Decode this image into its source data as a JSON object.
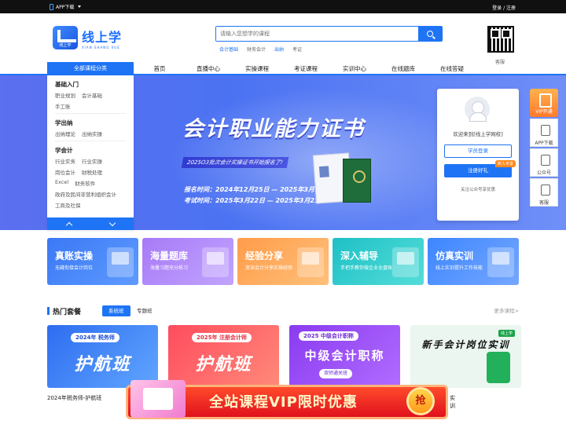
{
  "topbar": {
    "app_download": "APP下载",
    "login_register": "登录 / 注册"
  },
  "logo": {
    "name": "线上学",
    "pinyin": "XIAN SHANG XUE",
    "mark_text": "线上学"
  },
  "search": {
    "placeholder": "请输入您想学的课程",
    "hot": [
      "会计基础",
      "财务会计",
      "出纳",
      "考证"
    ]
  },
  "qr": {
    "label": "客服"
  },
  "nav": {
    "all_categories": "全部课程分类",
    "items": [
      "首页",
      "直播中心",
      "实操课程",
      "考证课程",
      "实训中心",
      "在线题库",
      "在线答疑"
    ]
  },
  "categories": [
    {
      "title": "基础入门",
      "rows": [
        [
          "职业规划",
          "会计基础"
        ],
        [
          "手工账"
        ]
      ]
    },
    {
      "title": "学出纳",
      "rows": [
        [
          "出纳理论",
          "出纳实操"
        ]
      ]
    },
    {
      "title": "学会计",
      "rows": [
        [
          "行业实务",
          "行业实操"
        ],
        [
          "岗位会计",
          "财税处理"
        ],
        [
          "Excel",
          "财务软件"
        ],
        [
          "政府及民间非营利组织会计"
        ],
        [
          "工商及社保"
        ]
      ]
    }
  ],
  "banner": {
    "title": "会计职业能力证书",
    "tag": "2025O3批次会计实操证书开始报名了!",
    "line1": "报名时间：2024年12月25日 — 2025年3月10日",
    "line2": "考试时间：2025年3月22日 — 2025年3月23日",
    "slide_count": 5,
    "active_slide": 1
  },
  "login_box": {
    "welcome": "欢迎来到[线上学网校]",
    "member_login": "学员登录",
    "register": "注册好礼",
    "badge": "新人专享",
    "follow": "关注公众号享优惠"
  },
  "side_tools": {
    "vip": "VIP开通",
    "items": [
      "APP下载",
      "公众号",
      "客服"
    ]
  },
  "features": [
    {
      "title": "真账实操",
      "sub": "无缝衔接会计岗位"
    },
    {
      "title": "海量题库",
      "sub": "海量习题充分练习"
    },
    {
      "title": "经验分享",
      "sub": "资深会计分享实操经验"
    },
    {
      "title": "深入辅导",
      "sub": "手把手教你做企业全盘账"
    },
    {
      "title": "仿真实训",
      "sub": "线上实训提升工作技能"
    }
  ],
  "hot_section": {
    "title": "热门套餐",
    "tabs": [
      "系统班",
      "专题班"
    ],
    "more": "更多课程>"
  },
  "courses": [
    {
      "tag": "2024年 税务师",
      "big": "护航班",
      "caption": "2024年税务师-护航班"
    },
    {
      "tag": "2025年 注册会计师",
      "big": "护航班",
      "caption": ""
    },
    {
      "tag": "2025 中级会计职称",
      "big": "中级会计职称",
      "sub": "双师通关班",
      "caption": ""
    },
    {
      "brand": "线上学",
      "big": "新手会计岗位实训",
      "caption": "实训"
    }
  ],
  "promo": {
    "text": "全站课程VIP限时优惠",
    "grab": "抢"
  }
}
